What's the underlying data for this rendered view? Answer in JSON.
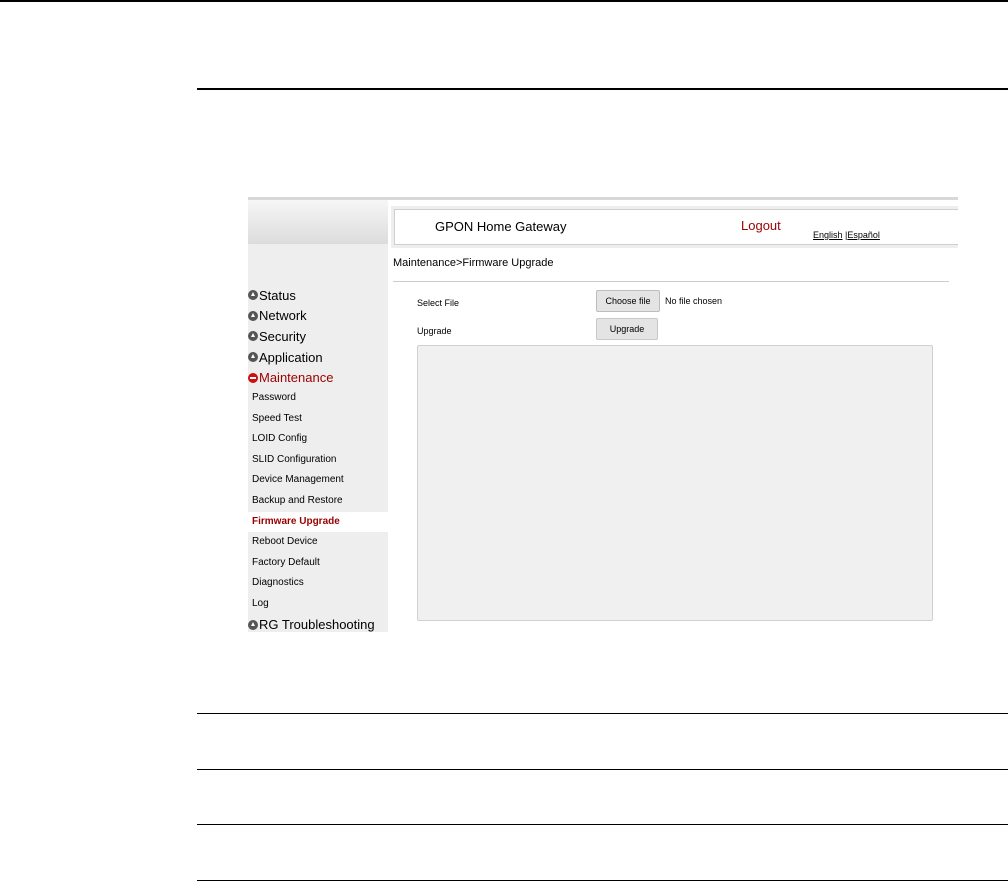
{
  "header": {
    "title": "GPON Home Gateway",
    "logout": "Logout",
    "lang_english": "English",
    "lang_sep": " |",
    "lang_spanish": "Español"
  },
  "breadcrumb": "Maintenance>Firmware Upgrade",
  "sidebar": {
    "top_items": [
      {
        "label": "Status"
      },
      {
        "label": "Network"
      },
      {
        "label": "Security"
      },
      {
        "label": "Application"
      },
      {
        "label": "Maintenance",
        "active": true
      }
    ],
    "sub_items": [
      {
        "label": "Password"
      },
      {
        "label": "Speed Test"
      },
      {
        "label": "LOID Config"
      },
      {
        "label": "SLID Configuration"
      },
      {
        "label": "Device Management"
      },
      {
        "label": "Backup and Restore"
      },
      {
        "label": "Firmware Upgrade",
        "current": true
      },
      {
        "label": "Reboot Device"
      },
      {
        "label": "Factory Default"
      },
      {
        "label": "Diagnostics"
      },
      {
        "label": "Log"
      }
    ],
    "bottom_item": {
      "label": "RG Troubleshooting"
    }
  },
  "form": {
    "select_file_label": "Select File",
    "choose_file_button": "Choose file",
    "no_file_text": "No file chosen",
    "upgrade_label": "Upgrade",
    "upgrade_button": "Upgrade"
  },
  "colors": {
    "accent": "#990000",
    "sidebar_bg": "#eeeeee",
    "log_bg": "#f0f0f0"
  }
}
